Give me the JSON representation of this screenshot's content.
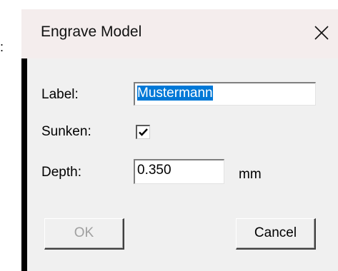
{
  "background": {
    "edge_text": ":"
  },
  "dialog": {
    "title": "Engrave Model",
    "close_glyph": "✕",
    "fields": {
      "label": {
        "caption": "Label:",
        "value": "Mustermann"
      },
      "sunken": {
        "caption": "Sunken:",
        "checked": true
      },
      "depth": {
        "caption": "Depth:",
        "value": "0.350",
        "unit": "mm"
      }
    },
    "buttons": {
      "ok": "OK",
      "cancel": "Cancel"
    }
  },
  "colors": {
    "selection": "#0078d7",
    "titlebar": "#f4eded",
    "dialog_background": "#f0f0f0",
    "disabled_text": "#a0a0a0"
  }
}
